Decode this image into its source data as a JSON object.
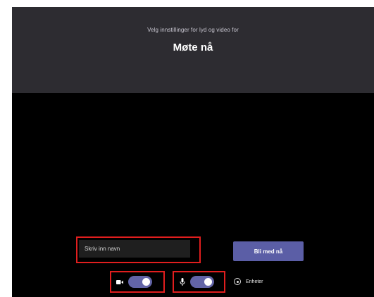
{
  "header": {
    "subtitle": "Velg innstillinger for lyd og video for",
    "title": "Møte nå"
  },
  "form": {
    "name_placeholder": "Skriv inn navn",
    "join_label": "Bli med nå"
  },
  "controls": {
    "camera_on": true,
    "mic_on": true,
    "devices_label": "Enheter"
  },
  "colors": {
    "accent": "#6264a7",
    "highlight": "#e01e1e"
  }
}
